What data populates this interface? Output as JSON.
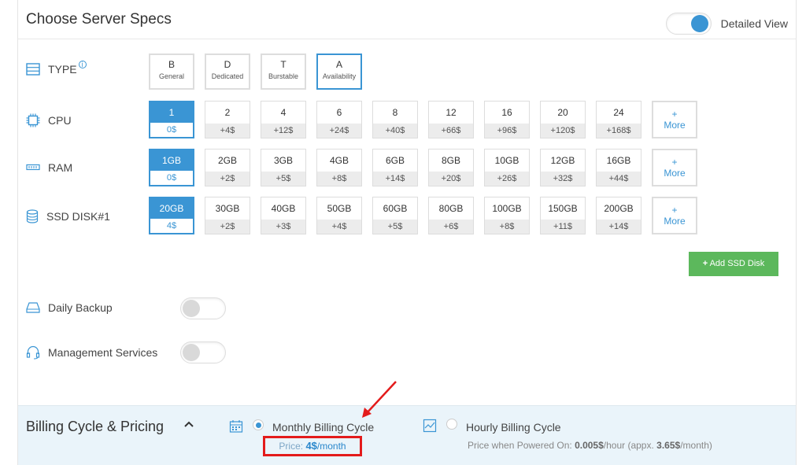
{
  "header": {
    "title": "Choose Server Specs",
    "detailed_view_label": "Detailed View"
  },
  "type_row": {
    "label": "TYPE",
    "info": "i",
    "options": [
      {
        "code": "B",
        "name": "General",
        "selected": false
      },
      {
        "code": "D",
        "name": "Dedicated",
        "selected": false
      },
      {
        "code": "T",
        "name": "Burstable",
        "selected": false
      },
      {
        "code": "A",
        "name": "Availability",
        "selected": true
      }
    ]
  },
  "cpu_row": {
    "label": "CPU",
    "options": [
      {
        "value": "1",
        "price": "0$",
        "selected": true
      },
      {
        "value": "2",
        "price": "+4$"
      },
      {
        "value": "4",
        "price": "+12$"
      },
      {
        "value": "6",
        "price": "+24$"
      },
      {
        "value": "8",
        "price": "+40$"
      },
      {
        "value": "12",
        "price": "+66$"
      },
      {
        "value": "16",
        "price": "+96$"
      },
      {
        "value": "20",
        "price": "+120$"
      },
      {
        "value": "24",
        "price": "+168$"
      }
    ],
    "more": {
      "plus": "+",
      "label": "More"
    }
  },
  "ram_row": {
    "label": "RAM",
    "options": [
      {
        "value": "1GB",
        "price": "0$",
        "selected": true
      },
      {
        "value": "2GB",
        "price": "+2$"
      },
      {
        "value": "3GB",
        "price": "+5$"
      },
      {
        "value": "4GB",
        "price": "+8$"
      },
      {
        "value": "6GB",
        "price": "+14$"
      },
      {
        "value": "8GB",
        "price": "+20$"
      },
      {
        "value": "10GB",
        "price": "+26$"
      },
      {
        "value": "12GB",
        "price": "+32$"
      },
      {
        "value": "16GB",
        "price": "+44$"
      }
    ],
    "more": {
      "plus": "+",
      "label": "More"
    }
  },
  "ssd_row": {
    "label": "SSD DISK#1",
    "options": [
      {
        "value": "20GB",
        "price": "4$",
        "selected": true
      },
      {
        "value": "30GB",
        "price": "+2$"
      },
      {
        "value": "40GB",
        "price": "+3$"
      },
      {
        "value": "50GB",
        "price": "+4$"
      },
      {
        "value": "60GB",
        "price": "+5$"
      },
      {
        "value": "80GB",
        "price": "+6$"
      },
      {
        "value": "100GB",
        "price": "+8$"
      },
      {
        "value": "150GB",
        "price": "+11$"
      },
      {
        "value": "200GB",
        "price": "+14$"
      }
    ],
    "more": {
      "plus": "+",
      "label": "More"
    }
  },
  "add_ssd": {
    "label": "Add SSD Disk",
    "icon": "+"
  },
  "daily_backup": {
    "label": "Daily Backup"
  },
  "management": {
    "label": "Management Services"
  },
  "billing": {
    "title": "Billing Cycle & Pricing",
    "chevron": "^",
    "monthly": {
      "label": "Monthly Billing Cycle",
      "price_label": "Price:",
      "price_value": "4$",
      "price_unit": "/month"
    },
    "hourly": {
      "label": "Hourly Billing Cycle",
      "prefix": "Price when Powered On:",
      "hour_value": "0.005$",
      "hour_unit": "/hour (appx.",
      "month_value": "3.65$",
      "month_unit": "/month)"
    }
  },
  "colors": {
    "accent": "#3a95d4",
    "green": "#5cb85c",
    "highlight": "#e31b1b"
  }
}
